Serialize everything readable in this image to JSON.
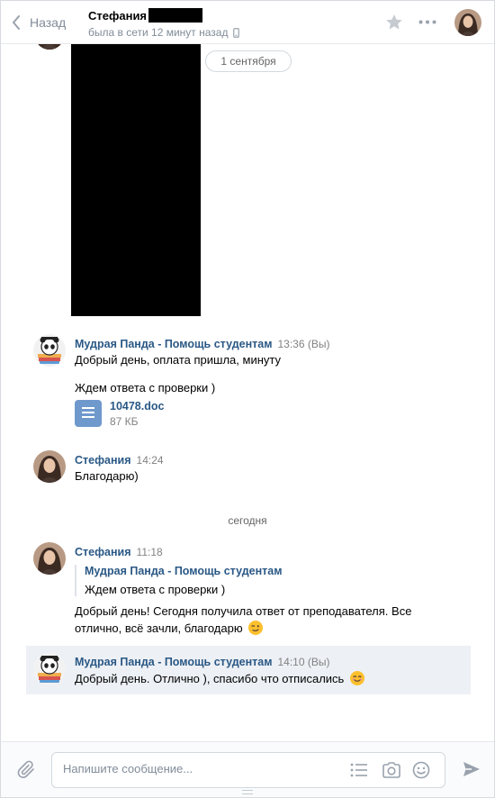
{
  "header": {
    "back_label": "Назад",
    "peer_name": "Стефания",
    "peer_status": "была в сети 12 минут назад"
  },
  "history": {
    "date_pill": "1 сентября",
    "date_separator": "сегодня"
  },
  "messages": [
    {
      "author": "Мудрая Панда - Помощь студентам",
      "time": "13:36 (Вы)",
      "lines": [
        "Добрый день, оплата пришла, минуту",
        "Ждем ответа с проверки )"
      ],
      "attachment": {
        "name": "10478.doc",
        "size": "87 КБ",
        "icon": "document-icon"
      }
    },
    {
      "author": "Стефания",
      "time": "14:24",
      "lines": [
        "Благодарю)"
      ]
    },
    {
      "author": "Стефания",
      "time": "11:18",
      "forwarded": {
        "author": "Мудрая Панда - Помощь студентам",
        "text": "Ждем ответа с проверки )"
      },
      "lines": [
        "Добрый день! Сегодня получила ответ от преподавателя. Все",
        "отлично, всё зачли, благодарю"
      ],
      "emoji": "winking-face-icon"
    },
    {
      "author": "Мудрая Панда - Помощь студентам",
      "time": "14:10 (Вы)",
      "lines": [
        "Добрый день. Отлично ), спасибо что отписались"
      ],
      "emoji": "smiling-face-icon",
      "selected": true
    }
  ],
  "composer": {
    "placeholder": "Напишите сообщение..."
  },
  "colors": {
    "link": "#2a5885",
    "muted": "#828282",
    "doc_icon": "#6f99cc",
    "selected_bg": "#edf0f5"
  }
}
